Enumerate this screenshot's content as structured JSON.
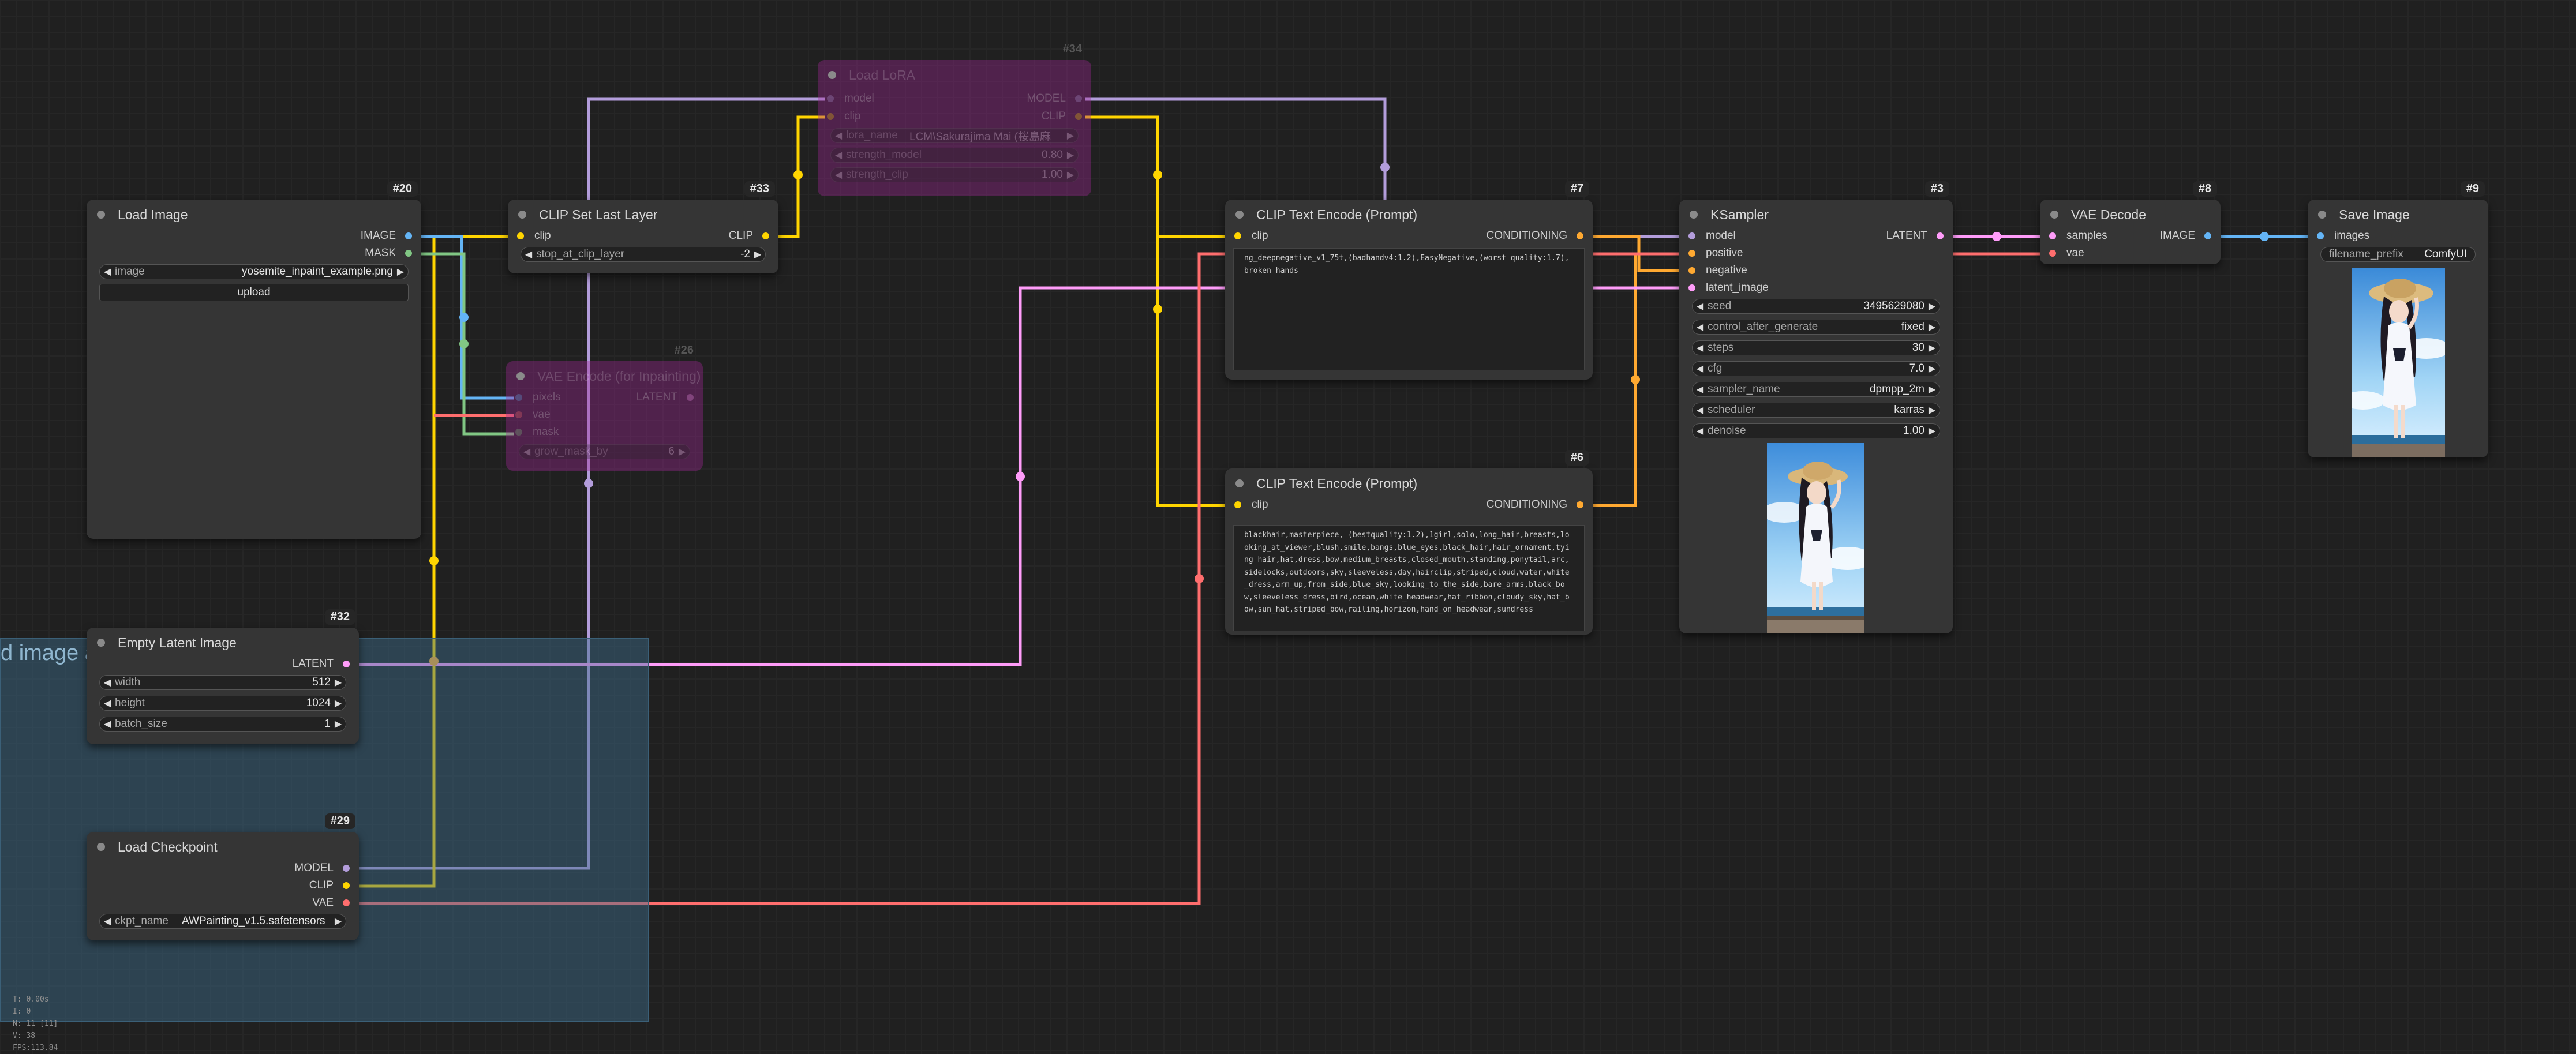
{
  "group": {
    "title": "d image a"
  },
  "colors": {
    "model": "#b39ddb",
    "clip": "#ffd500",
    "conditioning": "#ffa931",
    "latent": "#ff9cf9",
    "image": "#64b5f6",
    "vae": "#ff6e6e",
    "mask": "#81c784"
  },
  "nodes": {
    "load_image": {
      "id": "#20",
      "title": "Load Image",
      "outputs": [
        "IMAGE",
        "MASK"
      ],
      "image_label": "image",
      "image_value": "yosemite_inpaint_example.png",
      "upload_label": "upload"
    },
    "clip_set_last": {
      "id": "#33",
      "title": "CLIP Set Last Layer",
      "input": "clip",
      "output": "CLIP",
      "widget_label": "stop_at_clip_layer",
      "widget_value": "-2"
    },
    "load_lora": {
      "id": "#34",
      "title": "Load LoRA",
      "inputs": [
        "model",
        "clip"
      ],
      "outputs": [
        "MODEL",
        "CLIP"
      ],
      "lora_label": "lora_name",
      "lora_value": "LCM\\Sakurajima Mai (桜島麻",
      "strength_model_label": "strength_model",
      "strength_model_value": "0.80",
      "strength_clip_label": "strength_clip",
      "strength_clip_value": "1.00"
    },
    "vae_encode": {
      "id": "#26",
      "title": "VAE Encode (for Inpainting)",
      "inputs": [
        "pixels",
        "vae",
        "mask"
      ],
      "output": "LATENT",
      "widget_label": "grow_mask_by",
      "widget_value": "6"
    },
    "clip_text_encode_pos": {
      "id": "#7",
      "title": "CLIP Text Encode (Prompt)",
      "input": "clip",
      "output": "CONDITIONING",
      "text": "ng_deepnegative_v1_75t,(badhandv4:1.2),EasyNegative,(worst quality:1.7),broken hands"
    },
    "clip_text_encode_neg": {
      "id": "#6",
      "title": "CLIP Text Encode (Prompt)",
      "input": "clip",
      "output": "CONDITIONING",
      "text": "blackhair,masterpiece, (bestquality:1.2),1girl,solo,long_hair,breasts,looking_at_viewer,blush,smile,bangs,blue_eyes,black_hair,hair_ornament,tying hair,hat,dress,bow,medium_breasts,closed_mouth,standing,ponytail,arc,sidelocks,outdoors,sky,sleeveless,day,hairclip,striped,cloud,water,white_dress,arm_up,from_side,blue_sky,looking_to_the_side,bare_arms,black_bow,sleeveless_dress,bird,ocean,white_headwear,hat_ribbon,cloudy_sky,hat_bow,sun_hat,striped_bow,railing,horizon,hand_on_headwear,sundress"
    },
    "ksampler": {
      "id": "#3",
      "title": "KSampler",
      "inputs": [
        "model",
        "positive",
        "negative",
        "latent_image"
      ],
      "output": "LATENT",
      "widgets": [
        {
          "label": "seed",
          "value": "3495629080"
        },
        {
          "label": "control_after_generate",
          "value": "fixed"
        },
        {
          "label": "steps",
          "value": "30"
        },
        {
          "label": "cfg",
          "value": "7.0"
        },
        {
          "label": "sampler_name",
          "value": "dpmpp_2m"
        },
        {
          "label": "scheduler",
          "value": "karras"
        },
        {
          "label": "denoise",
          "value": "1.00"
        }
      ]
    },
    "vae_decode": {
      "id": "#8",
      "title": "VAE Decode",
      "inputs": [
        "samples",
        "vae"
      ],
      "output": "IMAGE"
    },
    "save_image": {
      "id": "#9",
      "title": "Save Image",
      "input": "images",
      "prefix_label": "filename_prefix",
      "prefix_value": "ComfyUI"
    },
    "empty_latent": {
      "id": "#32",
      "title": "Empty Latent Image",
      "output": "LATENT",
      "widgets": [
        {
          "label": "width",
          "value": "512"
        },
        {
          "label": "height",
          "value": "1024"
        },
        {
          "label": "batch_size",
          "value": "1"
        }
      ]
    },
    "load_checkpoint": {
      "id": "#29",
      "title": "Load Checkpoint",
      "outputs": [
        "MODEL",
        "CLIP",
        "VAE"
      ],
      "ckpt_label": "ckpt_name",
      "ckpt_value": "AWPainting_v1.5.safetensors"
    }
  },
  "stats": [
    "T: 0.00s",
    "I: 0",
    "N: 11 [11]",
    "V: 38",
    "FPS:113.84"
  ]
}
